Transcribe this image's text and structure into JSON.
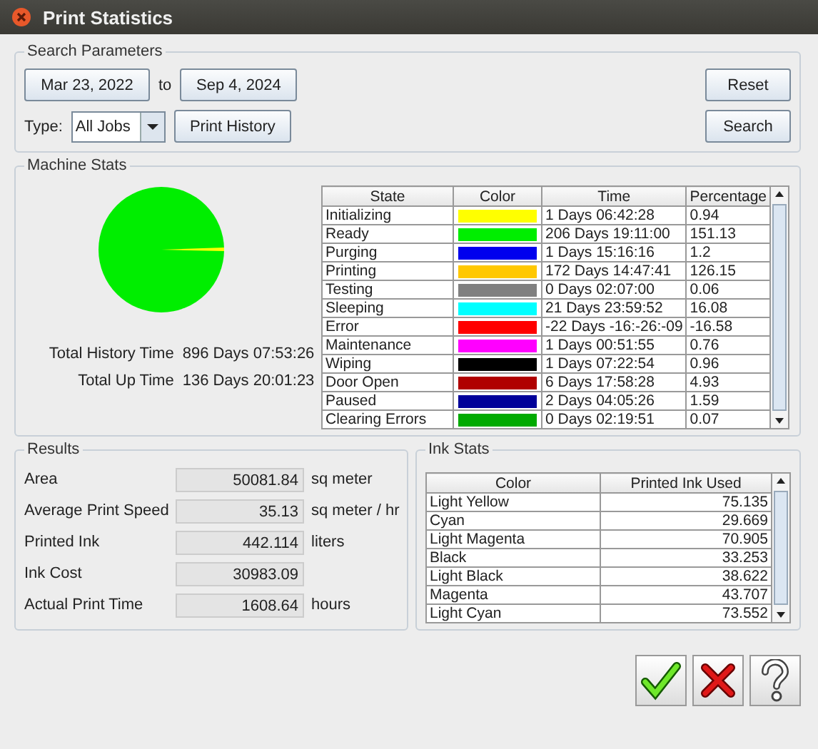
{
  "window": {
    "title": "Print Statistics"
  },
  "search_parameters": {
    "title": "Search Parameters",
    "from_date": "Mar 23, 2022",
    "to_label": "to",
    "to_date": "Sep 4, 2024",
    "type_label": "Type:",
    "type_value": "All Jobs",
    "print_history_button": "Print History",
    "reset_button": "Reset",
    "search_button": "Search"
  },
  "machine_stats": {
    "title": "Machine Stats",
    "totals": [
      {
        "label": "Total History Time",
        "value": "896 Days 07:53:26"
      },
      {
        "label": "Total Up Time",
        "value": "136 Days 20:01:23"
      }
    ],
    "columns": [
      "State",
      "Color",
      "Time",
      "Percentage"
    ],
    "rows": [
      {
        "state": "Initializing",
        "color": "#ffff00",
        "time": "1 Days 06:42:28",
        "percentage": "0.94"
      },
      {
        "state": "Ready",
        "color": "#00ee00",
        "time": "206 Days 19:11:00",
        "percentage": "151.13"
      },
      {
        "state": "Purging",
        "color": "#0000ee",
        "time": "1 Days 15:16:16",
        "percentage": "1.2"
      },
      {
        "state": "Printing",
        "color": "#ffc800",
        "time": "172 Days 14:47:41",
        "percentage": "126.15"
      },
      {
        "state": "Testing",
        "color": "#808080",
        "time": "0 Days 02:07:00",
        "percentage": "0.06"
      },
      {
        "state": "Sleeping",
        "color": "#00ffff",
        "time": "21 Days 23:59:52",
        "percentage": "16.08"
      },
      {
        "state": "Error",
        "color": "#ff0000",
        "time": "-22 Days -16:-26:-09",
        "percentage": "-16.58"
      },
      {
        "state": "Maintenance",
        "color": "#ff00ff",
        "time": "1 Days 00:51:55",
        "percentage": "0.76"
      },
      {
        "state": "Wiping",
        "color": "#000000",
        "time": "1 Days 07:22:54",
        "percentage": "0.96"
      },
      {
        "state": "Door Open",
        "color": "#b00000",
        "time": "6 Days 17:58:28",
        "percentage": "4.93"
      },
      {
        "state": "Paused",
        "color": "#000099",
        "time": "2 Days 04:05:26",
        "percentage": "1.59"
      },
      {
        "state": "Clearing Errors",
        "color": "#00aa00",
        "time": "0 Days 02:19:51",
        "percentage": "0.07"
      }
    ]
  },
  "results": {
    "title": "Results",
    "rows": [
      {
        "label": "Area",
        "value": "50081.84",
        "unit": "sq meter"
      },
      {
        "label": "Average Print Speed",
        "value": "35.13",
        "unit": "sq meter / hr"
      },
      {
        "label": "Printed Ink",
        "value": "442.114",
        "unit": "liters"
      },
      {
        "label": "Ink Cost",
        "value": "30983.09"
      },
      {
        "label": "Actual Print Time",
        "value": "1608.64",
        "unit": "hours"
      }
    ]
  },
  "ink_stats": {
    "title": "Ink Stats",
    "columns": [
      "Color",
      "Printed Ink Used"
    ],
    "rows": [
      {
        "color_name": "Light Yellow",
        "used": "75.135"
      },
      {
        "color_name": "Cyan",
        "used": "29.669"
      },
      {
        "color_name": "Light Magenta",
        "used": "70.905"
      },
      {
        "color_name": "Black",
        "used": "33.253"
      },
      {
        "color_name": "Light Black",
        "used": "38.622"
      },
      {
        "color_name": "Magenta",
        "used": "43.707"
      },
      {
        "color_name": "Light Cyan",
        "used": "73.552"
      }
    ]
  },
  "dialog_buttons": [
    {
      "kind": "ok"
    },
    {
      "kind": "cancel"
    },
    {
      "kind": "help"
    }
  ]
}
